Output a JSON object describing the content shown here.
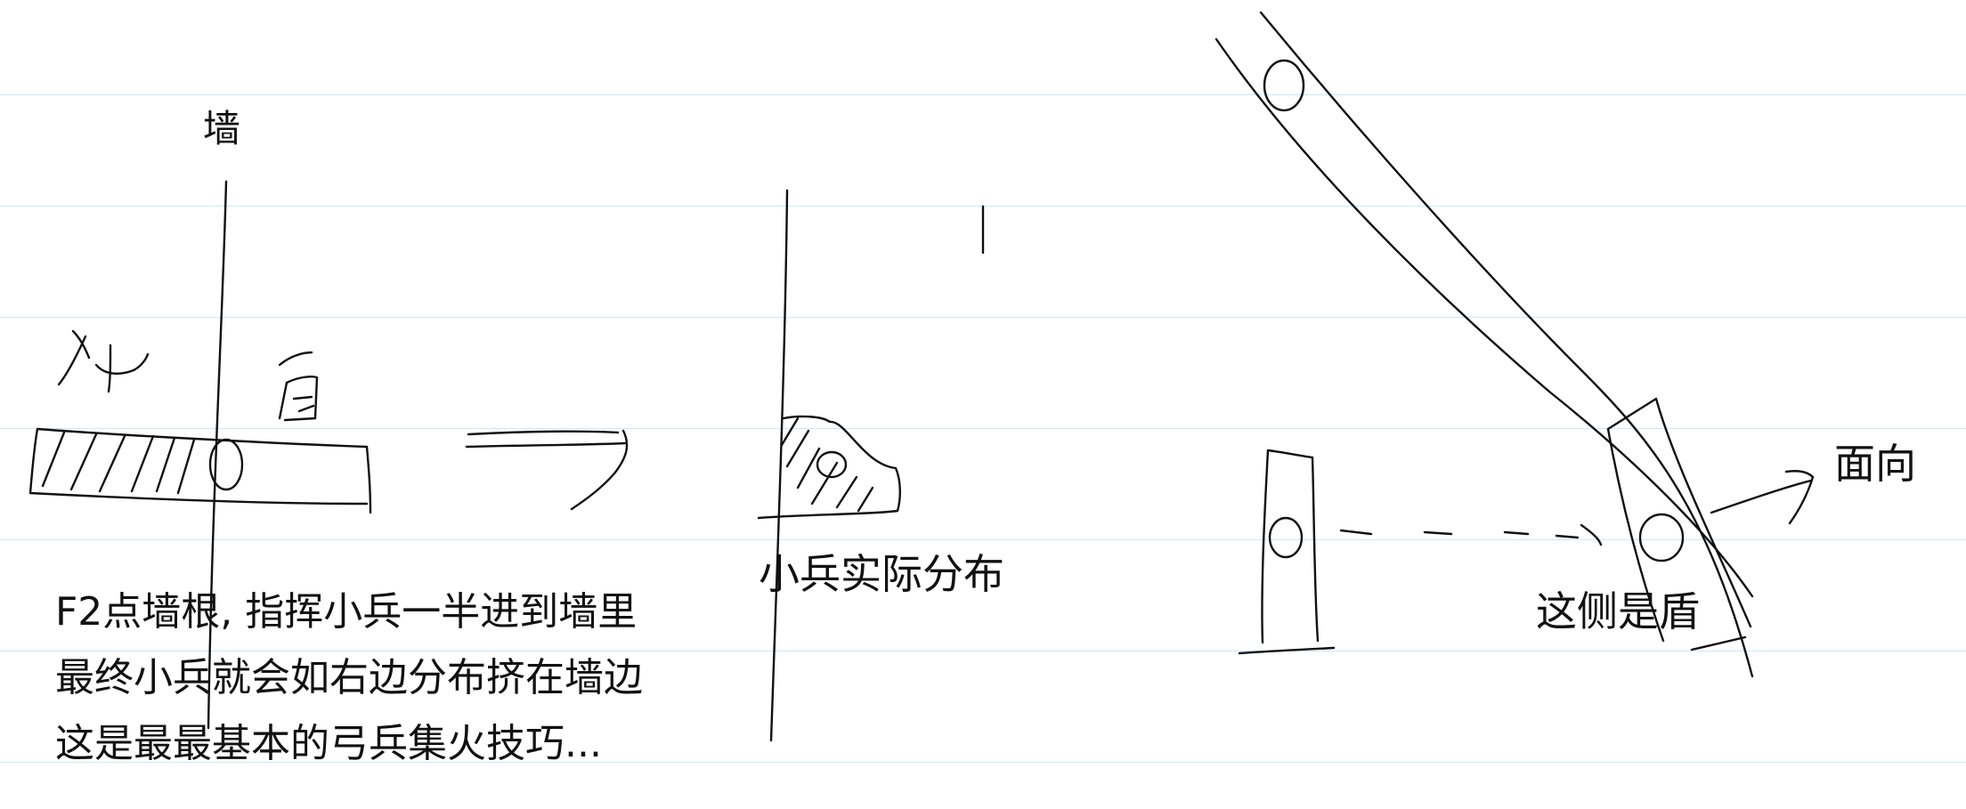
{
  "labels": {
    "wall": "墙",
    "soldier_distribution": "小兵实际分布",
    "shield_side": "这侧是盾",
    "facing": "面向"
  },
  "notes": [
    "F2点墙根, 指挥小兵一半进到墙里",
    "最终小兵就会如右边分布挤在墙边",
    "这是最最基本的弓兵集火技巧..."
  ],
  "handwriting": {
    "left_side": "外",
    "right_side": "内"
  },
  "colors": {
    "ink": "#111111",
    "ruled_line": "#cfe6f5",
    "paper": "#ffffff"
  }
}
